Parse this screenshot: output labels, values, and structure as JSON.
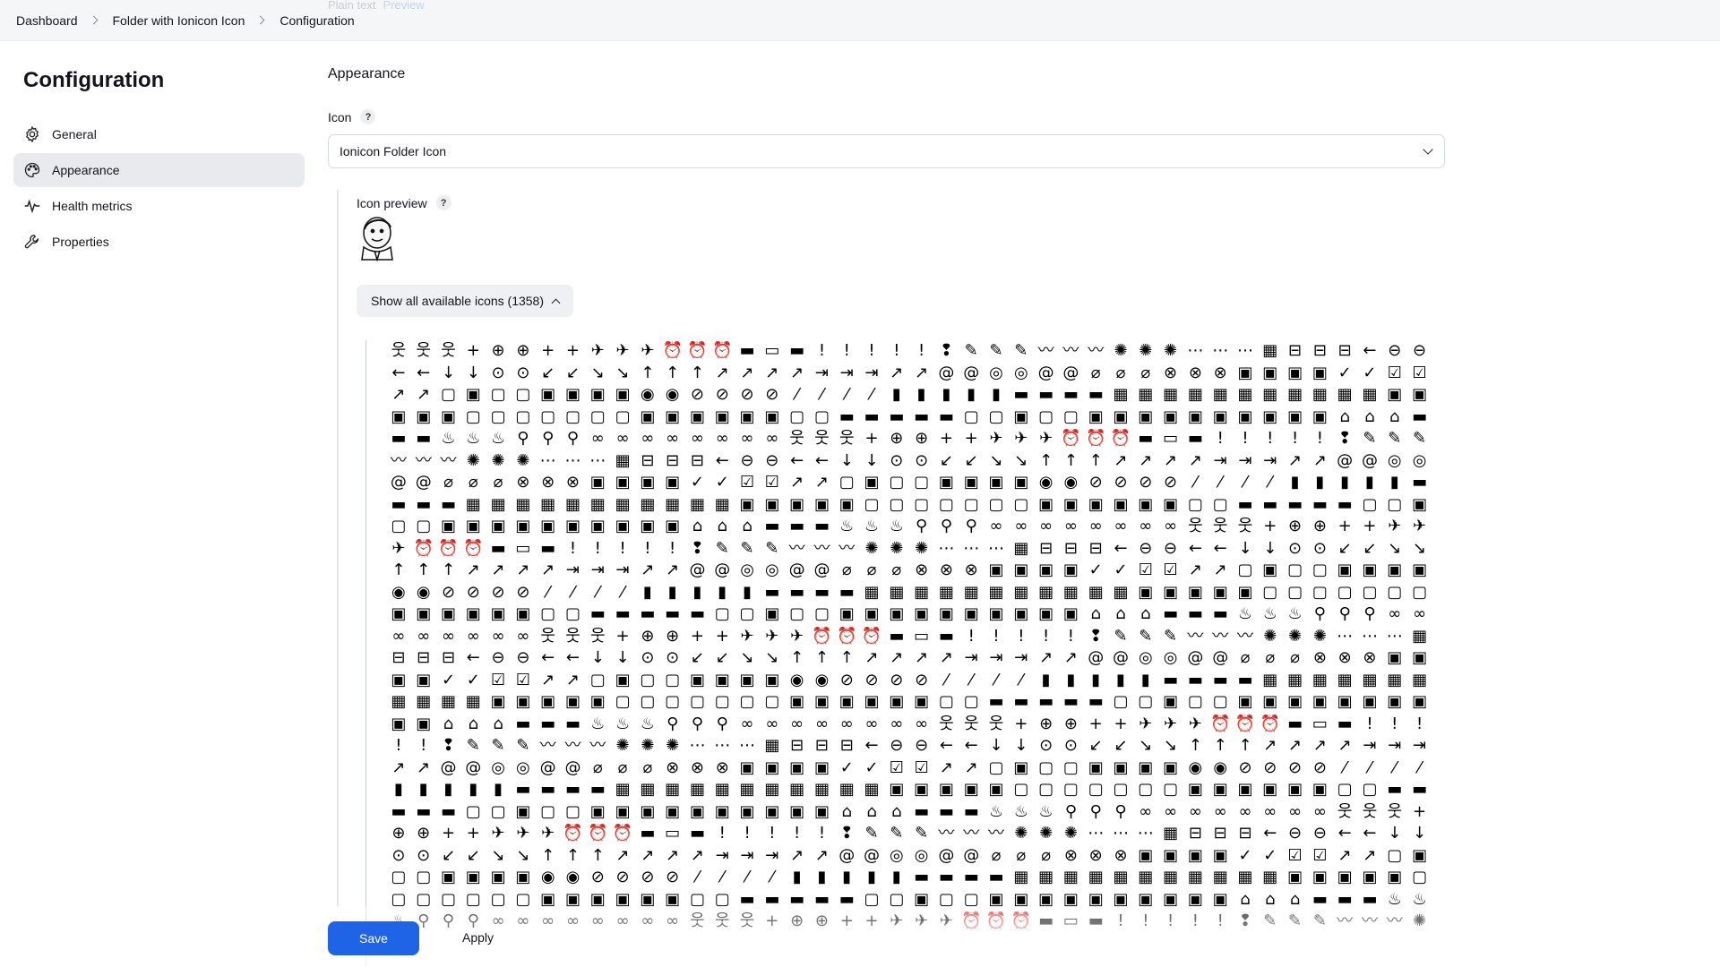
{
  "breadcrumb": [
    "Dashboard",
    "Folder with Ionicon Icon",
    "Configuration"
  ],
  "ghost": {
    "text": "Plain text",
    "link": "Preview"
  },
  "sidebar": {
    "title": "Configuration",
    "items": [
      {
        "label": "General",
        "icon": "gear-icon",
        "active": false
      },
      {
        "label": "Appearance",
        "icon": "palette-icon",
        "active": true
      },
      {
        "label": "Health metrics",
        "icon": "pulse-icon",
        "active": false
      },
      {
        "label": "Properties",
        "icon": "wrench-icon",
        "active": false
      }
    ]
  },
  "main": {
    "section_title": "Appearance",
    "icon_label": "Icon",
    "help": "?",
    "icon_select_value": "Ionicon Folder Icon",
    "preview_label": "Icon preview",
    "show_icons_button": "Show all available icons (1358)",
    "icon_glyphs": "웃웃웃+⊕⊕++✈✈✈⏰⏰⏰▬▭▬!!!!!❢✎✎✎〰〰〰✺✺✺⋯⋯⋯▦⊟⊟⊟←⊖⊖←←↓↓⊙⊙↙↙↘↘↑↑↑↗↗↗↗⇥⇥⇥↗↗@@◎◎@@⌀⌀⌀⊗⊗⊗▣▣▣▣✓✓☑☑↗↗▢▣▢▢▣▣▣▣◉◉⊘⊘⊘⊘⁄⁄⁄⁄▮▮▮▮▮▬▬▬▬▦▦▦▦▦▦▦▦▦▦▦▣▣▣▣▣▢▢▢▢▢▢▢▣▣▣▣▣▣▢▢▬▬▬▬▬▢▢▣▢▢▣▣▣▣▣▣▣▣▣▣⌂⌂⌂▬▬▬♨♨♨⚲⚲⚲∞∞∞∞∞∞∞∞"
  },
  "footer": {
    "save": "Save",
    "apply": "Apply"
  }
}
